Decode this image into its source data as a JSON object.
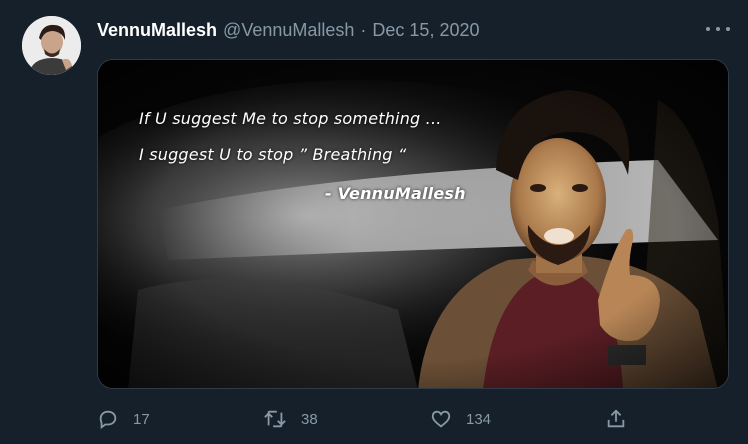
{
  "tweet": {
    "display_name": "VennuMallesh",
    "handle": "@VennuMallesh",
    "separator": "·",
    "date": "Dec 15, 2020",
    "more_icon": "more-horizontal-icon"
  },
  "media": {
    "quote_line1": "If U suggest Me to stop something ...",
    "quote_line2": "I suggest U to stop ” Breathing “",
    "quote_signature": "- VennuMallesh"
  },
  "actions": {
    "reply_count": "17",
    "retweet_count": "38",
    "like_count": "134",
    "icons": [
      "reply-icon",
      "retweet-icon",
      "like-icon",
      "share-icon"
    ]
  },
  "colors": {
    "background": "#15202b",
    "muted_text": "#8899a6",
    "primary_text": "#ffffff"
  }
}
